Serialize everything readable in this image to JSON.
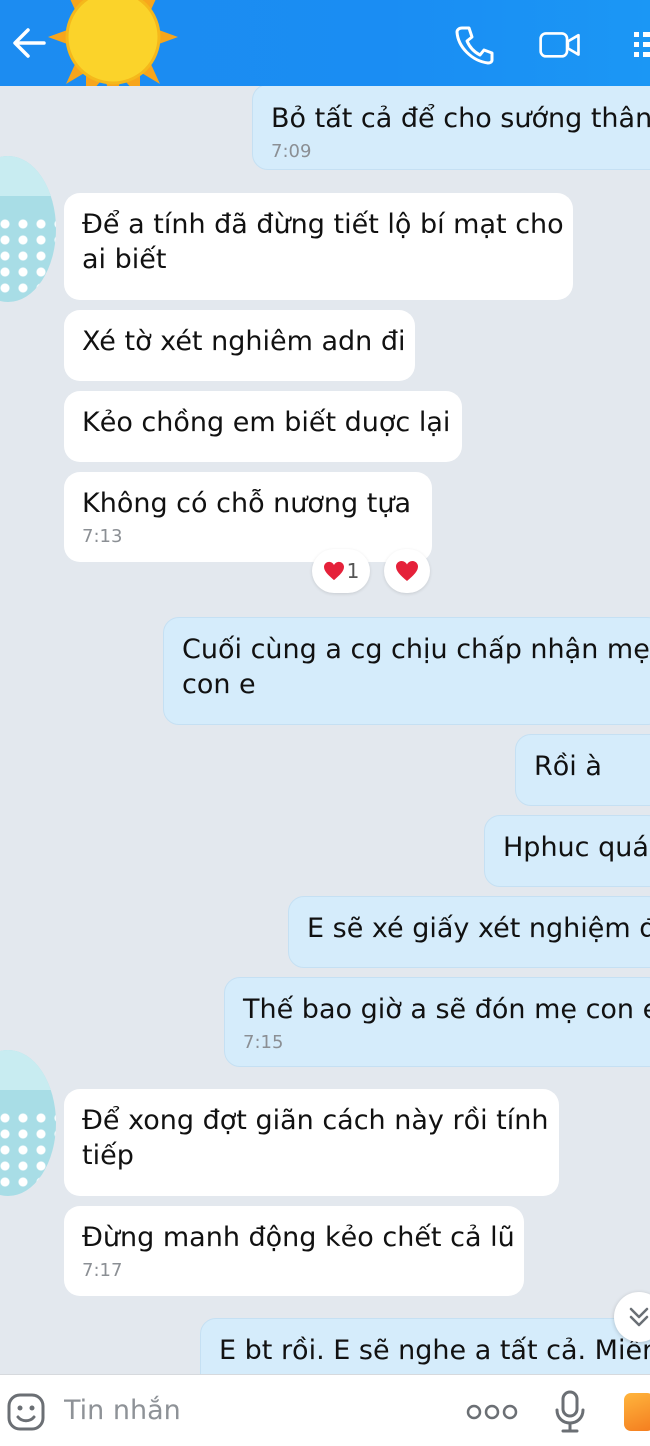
{
  "composer": {
    "placeholder": "Tin nhắn"
  },
  "messages": [
    {
      "text": "Bỏ tất cả để cho sướng thân",
      "time": "7:09"
    },
    {
      "text": "Để a tính đã đừng tiết lộ bí mạt cho"
    },
    {
      "text": "ai biết"
    },
    {
      "text": "Xé tờ xét nghiêm adn đi"
    },
    {
      "text": "Kẻo chồng em biết duợc lại"
    },
    {
      "text": "Không có chỗ nương tựa",
      "time": "7:13"
    },
    {
      "text": "Cuối cùng a cg chịu chấp nhận mẹ"
    },
    {
      "text": "con e"
    },
    {
      "text": "Rồi à"
    },
    {
      "text": "Hphuc quá"
    },
    {
      "text": "E sẽ xé giấy xét nghiệm đi"
    },
    {
      "text": "Thế bao giờ a sẽ đón mẹ con e",
      "time": "7:15"
    },
    {
      "text": "Để xong đợt giãn cách này rồi tính"
    },
    {
      "text": "tiếp"
    },
    {
      "text": "Đừng manh động kẻo chết cả lũ",
      "time": "7:17"
    },
    {
      "text": "E bt rồi. E sẽ nghe a tất cả. Miễn"
    }
  ],
  "reaction": {
    "count": "1"
  },
  "icons": {
    "back": "back-arrow-icon",
    "phone": "phone-icon",
    "video": "video-camera-icon",
    "menu": "menu-icon",
    "sticker": "sticker-smile-icon",
    "more": "more-dots-icon",
    "mic": "microphone-icon",
    "image": "image-icon",
    "scroll": "chevron-double-down-icon"
  },
  "colors": {
    "header": "#1a8df3",
    "incoming_bubble": "#ffffff",
    "outgoing_bubble": "#d5ecfb",
    "background": "#e3e8ee",
    "heart": "#e5213a"
  }
}
